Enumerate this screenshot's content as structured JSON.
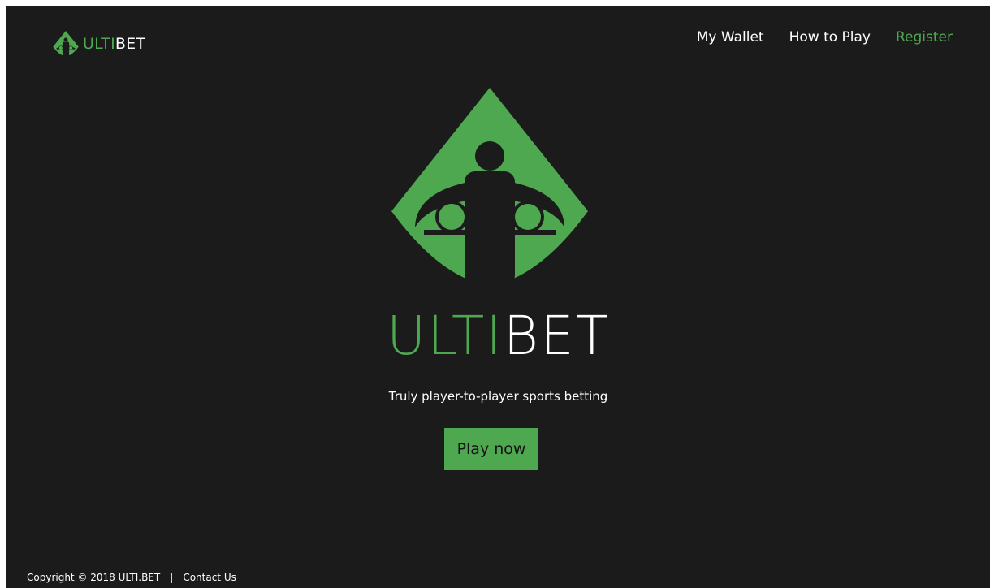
{
  "brand": {
    "text_green": "ULTI",
    "text_white": "BET",
    "logo_icon": "three-players-diamond-icon"
  },
  "nav": {
    "items": [
      {
        "label": "My Wallet"
      },
      {
        "label": "How to Play"
      },
      {
        "label": "Register"
      }
    ]
  },
  "hero": {
    "logo_icon": "three-players-diamond-icon",
    "title_green": "ULTI",
    "title_white": "BET",
    "tagline": "Truly player-to-player sports betting",
    "cta_label": "Play now"
  },
  "footer": {
    "copyright": "Copyright © 2018 ULTI.BET",
    "separator": "|",
    "contact_label": "Contact Us"
  },
  "colors": {
    "background": "#1b1b1b",
    "accent": "#4ea84f",
    "text": "#ffffff"
  }
}
